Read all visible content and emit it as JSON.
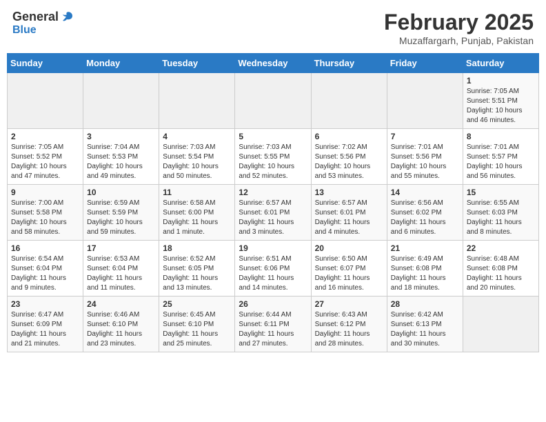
{
  "header": {
    "logo_general": "General",
    "logo_blue": "Blue",
    "month_title": "February 2025",
    "location": "Muzaffargarh, Punjab, Pakistan"
  },
  "weekdays": [
    "Sunday",
    "Monday",
    "Tuesday",
    "Wednesday",
    "Thursday",
    "Friday",
    "Saturday"
  ],
  "weeks": [
    [
      {
        "day": "",
        "info": ""
      },
      {
        "day": "",
        "info": ""
      },
      {
        "day": "",
        "info": ""
      },
      {
        "day": "",
        "info": ""
      },
      {
        "day": "",
        "info": ""
      },
      {
        "day": "",
        "info": ""
      },
      {
        "day": "1",
        "info": "Sunrise: 7:05 AM\nSunset: 5:51 PM\nDaylight: 10 hours\nand 46 minutes."
      }
    ],
    [
      {
        "day": "2",
        "info": "Sunrise: 7:05 AM\nSunset: 5:52 PM\nDaylight: 10 hours\nand 47 minutes."
      },
      {
        "day": "3",
        "info": "Sunrise: 7:04 AM\nSunset: 5:53 PM\nDaylight: 10 hours\nand 49 minutes."
      },
      {
        "day": "4",
        "info": "Sunrise: 7:03 AM\nSunset: 5:54 PM\nDaylight: 10 hours\nand 50 minutes."
      },
      {
        "day": "5",
        "info": "Sunrise: 7:03 AM\nSunset: 5:55 PM\nDaylight: 10 hours\nand 52 minutes."
      },
      {
        "day": "6",
        "info": "Sunrise: 7:02 AM\nSunset: 5:56 PM\nDaylight: 10 hours\nand 53 minutes."
      },
      {
        "day": "7",
        "info": "Sunrise: 7:01 AM\nSunset: 5:56 PM\nDaylight: 10 hours\nand 55 minutes."
      },
      {
        "day": "8",
        "info": "Sunrise: 7:01 AM\nSunset: 5:57 PM\nDaylight: 10 hours\nand 56 minutes."
      }
    ],
    [
      {
        "day": "9",
        "info": "Sunrise: 7:00 AM\nSunset: 5:58 PM\nDaylight: 10 hours\nand 58 minutes."
      },
      {
        "day": "10",
        "info": "Sunrise: 6:59 AM\nSunset: 5:59 PM\nDaylight: 10 hours\nand 59 minutes."
      },
      {
        "day": "11",
        "info": "Sunrise: 6:58 AM\nSunset: 6:00 PM\nDaylight: 11 hours\nand 1 minute."
      },
      {
        "day": "12",
        "info": "Sunrise: 6:57 AM\nSunset: 6:01 PM\nDaylight: 11 hours\nand 3 minutes."
      },
      {
        "day": "13",
        "info": "Sunrise: 6:57 AM\nSunset: 6:01 PM\nDaylight: 11 hours\nand 4 minutes."
      },
      {
        "day": "14",
        "info": "Sunrise: 6:56 AM\nSunset: 6:02 PM\nDaylight: 11 hours\nand 6 minutes."
      },
      {
        "day": "15",
        "info": "Sunrise: 6:55 AM\nSunset: 6:03 PM\nDaylight: 11 hours\nand 8 minutes."
      }
    ],
    [
      {
        "day": "16",
        "info": "Sunrise: 6:54 AM\nSunset: 6:04 PM\nDaylight: 11 hours\nand 9 minutes."
      },
      {
        "day": "17",
        "info": "Sunrise: 6:53 AM\nSunset: 6:04 PM\nDaylight: 11 hours\nand 11 minutes."
      },
      {
        "day": "18",
        "info": "Sunrise: 6:52 AM\nSunset: 6:05 PM\nDaylight: 11 hours\nand 13 minutes."
      },
      {
        "day": "19",
        "info": "Sunrise: 6:51 AM\nSunset: 6:06 PM\nDaylight: 11 hours\nand 14 minutes."
      },
      {
        "day": "20",
        "info": "Sunrise: 6:50 AM\nSunset: 6:07 PM\nDaylight: 11 hours\nand 16 minutes."
      },
      {
        "day": "21",
        "info": "Sunrise: 6:49 AM\nSunset: 6:08 PM\nDaylight: 11 hours\nand 18 minutes."
      },
      {
        "day": "22",
        "info": "Sunrise: 6:48 AM\nSunset: 6:08 PM\nDaylight: 11 hours\nand 20 minutes."
      }
    ],
    [
      {
        "day": "23",
        "info": "Sunrise: 6:47 AM\nSunset: 6:09 PM\nDaylight: 11 hours\nand 21 minutes."
      },
      {
        "day": "24",
        "info": "Sunrise: 6:46 AM\nSunset: 6:10 PM\nDaylight: 11 hours\nand 23 minutes."
      },
      {
        "day": "25",
        "info": "Sunrise: 6:45 AM\nSunset: 6:10 PM\nDaylight: 11 hours\nand 25 minutes."
      },
      {
        "day": "26",
        "info": "Sunrise: 6:44 AM\nSunset: 6:11 PM\nDaylight: 11 hours\nand 27 minutes."
      },
      {
        "day": "27",
        "info": "Sunrise: 6:43 AM\nSunset: 6:12 PM\nDaylight: 11 hours\nand 28 minutes."
      },
      {
        "day": "28",
        "info": "Sunrise: 6:42 AM\nSunset: 6:13 PM\nDaylight: 11 hours\nand 30 minutes."
      },
      {
        "day": "",
        "info": ""
      }
    ]
  ]
}
